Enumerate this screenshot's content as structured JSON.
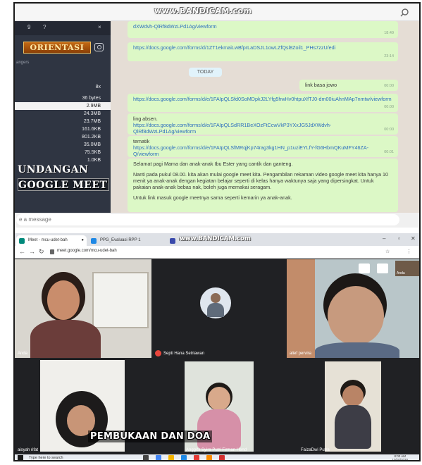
{
  "chat": {
    "watermark": "www.BANDICAM.com",
    "sidebar": {
      "header_icons": [
        "9",
        "?",
        "×"
      ],
      "banner": "ORIENTASI",
      "sub_label": "angers",
      "sub_value": "8x",
      "sizes": [
        "36 bytes",
        "2.9MB",
        "24.3MB",
        "23.7MB",
        "161.6KB",
        "801.2KB",
        "35.0MB",
        "75.5KB",
        "1.0KB"
      ],
      "overlay_1": "UNDANGAN",
      "overlay_2": "GOOGLE MEET"
    },
    "messages": [
      {
        "text": "dXWdvh-QlRf8dWzLPd1Ag/viewform",
        "time": "18:49"
      },
      {
        "text": "https://docs.google.com/forms/d/1ZT1ekmaiLwBfprLaDSJL1owLZfQsl8Zoil1_PHs7zzU/edi",
        "time": "23:14"
      },
      {
        "text": "TODAY"
      },
      {
        "text": "link basa jowo",
        "time": "00:00"
      },
      {
        "text": "https://docs.google.com/forms/d/e/1FAIpQLSfd0SoMDpkJ2LYfg5hwHv0htpuXfTJ0-dm00iuAhnMAp7nmtw/viewform",
        "time": "00:00"
      },
      {
        "label": "ling absen.",
        "text": "https://docs.google.com/forms/d/e/1FAIpQLSdRR1BeXOzFtCcwVkP3YXxJG5JdXWdvh-QlRf8dWzLPd1Ag/viewform",
        "time": "00:00"
      },
      {
        "label": "tematik",
        "text": "https://docs.google.com/forms/d/e/1FAIpQLSfMRqjKp74rag3kg1HN_p1uziEYLfY-fG6HbmQKuMFY46ZA-Q/viewform",
        "time": "00:01"
      },
      {
        "p1": "Selamat pagi Mama dan anak-anak Ibu Ester yang cantik dan ganteng.",
        "p2": "Nanti pada pukul 08.00. kita akan mulai google meet kita. Pengambilan rekaman video google meet kita hanya 10 menit ya anak-anak dengan kegiatan belajar seperti di kelas hanya waktunya saja yang dipersingkat. Untuk pakaian anak-anak bebas nak, boleh juga memakai seragam.",
        "p3": "Untuk link masuk google meetnya sama seperti kemarin ya anak-anak."
      }
    ],
    "input_placeholder": "e a message"
  },
  "meet": {
    "watermark": "www.BANDICAM.com",
    "tabs": [
      "Meet - mcu-udet-bah",
      "PPG_Evaluasi RPP 1",
      "Hika"
    ],
    "url": "meet.google.com/mcu-udet-bah",
    "participants": [
      "Anda",
      "Septi Hana Setriawan",
      "alief pervira",
      "aisyah rifat",
      "Anggita Syira Putri Firman Hend",
      "FaizaDwi Putra"
    ],
    "self_preview_label": "Anda",
    "caption": "PEMBUKAAN DAN DOA"
  },
  "taskbar": {
    "search_placeholder": "Type here to search",
    "time": "8:00 AM",
    "date": "10/10/2020"
  },
  "colors": {
    "bubble": "#dcf8c6",
    "chat_bg": "#e5ddd5",
    "sidebar": "#2f3542",
    "link": "#2d6fbf",
    "meet_bg": "#202124"
  }
}
